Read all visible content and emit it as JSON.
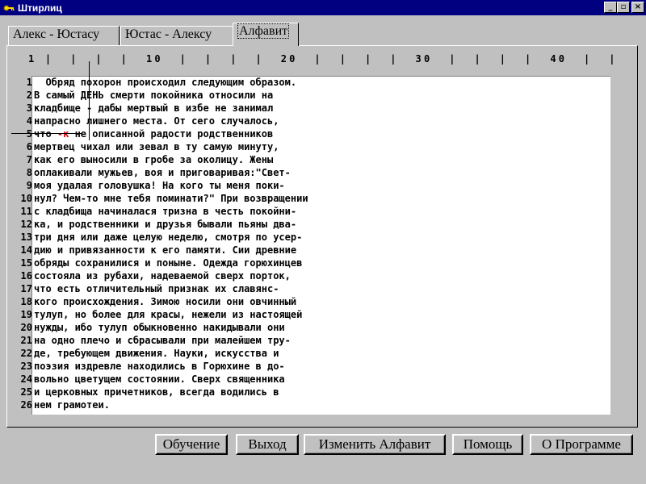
{
  "window": {
    "title": "Штирлиц",
    "icon": "key-icon",
    "buttons": [
      "_",
      "▫",
      "×"
    ]
  },
  "tabs": [
    {
      "label": "Алекс - Юстасу",
      "active": false
    },
    {
      "label": "Юстас - Алексу",
      "active": false
    },
    {
      "label": "Алфавит",
      "active": true
    }
  ],
  "ruler": "1 |  |  |  |  10  |  |  |  |  20  |  |  |  |  30  |  |  |  |  40  |  |",
  "line_numbers": [
    "1",
    "2",
    "3",
    "4",
    "5",
    "6",
    "7",
    "8",
    "9",
    "10",
    "11",
    "12",
    "13",
    "14",
    "15",
    "16",
    "17",
    "18",
    "19",
    "20",
    "21",
    "22",
    "23",
    "24",
    "25",
    "26"
  ],
  "lines": [
    "  Обряд похорон происходил следующим образом.",
    "В самый ДЕНЬ смерти покойника относили на",
    "кладбище - дабы мертвый в избе не занимал",
    "напрасно лишнего места. От сего случалось,",
    "что ",
    "мертвец чихал или зевал в ту самую минуту,",
    "как его выносили в гробе за околицу. Жены",
    "оплакивали мужьев, воя и приговаривая:\"Свет-",
    "моя удалая головушка! На кого ты меня поки-",
    "нул? Чем-то мне тебя поминати?\" При возвращении",
    "с кладбища начиналася тризна в честь покойни-",
    "ка, и родственники и друзья бывали пьяны два-",
    "три дня или даже целую неделю, смотря по усер-",
    "дию и привязанности к его памяти. Сии древние",
    "обряды сохранилися и поныне. Одежда горюхинцев",
    "состояла из рубахи, надеваемой сверх порток,",
    "что есть отличительный признак их славянс-",
    "кого происхождения. Зимою носили они овчинный",
    "тулуп, но более для красы, нежели из настоящей",
    "нужды, ибо тулуп обыкновенно накидывали они",
    "на одно плечо и сбрасывали при малейшем тру-",
    "де, требующем движения. Науки, искусства и",
    "поэзия издревле находились в Горюхине в до-",
    "вольно цветущем состоянии. Сверх священника",
    "и церковных причетников, всегда водились в",
    "нем грамотеи."
  ],
  "line5_red": "-к",
  "line5_rest": " не описанной радости родственников",
  "buttons": {
    "learn": "Обучение",
    "exit": "Выход",
    "change_alphabet": "Изменить Алфавит",
    "help": "Помощь",
    "about": "О Программе"
  }
}
